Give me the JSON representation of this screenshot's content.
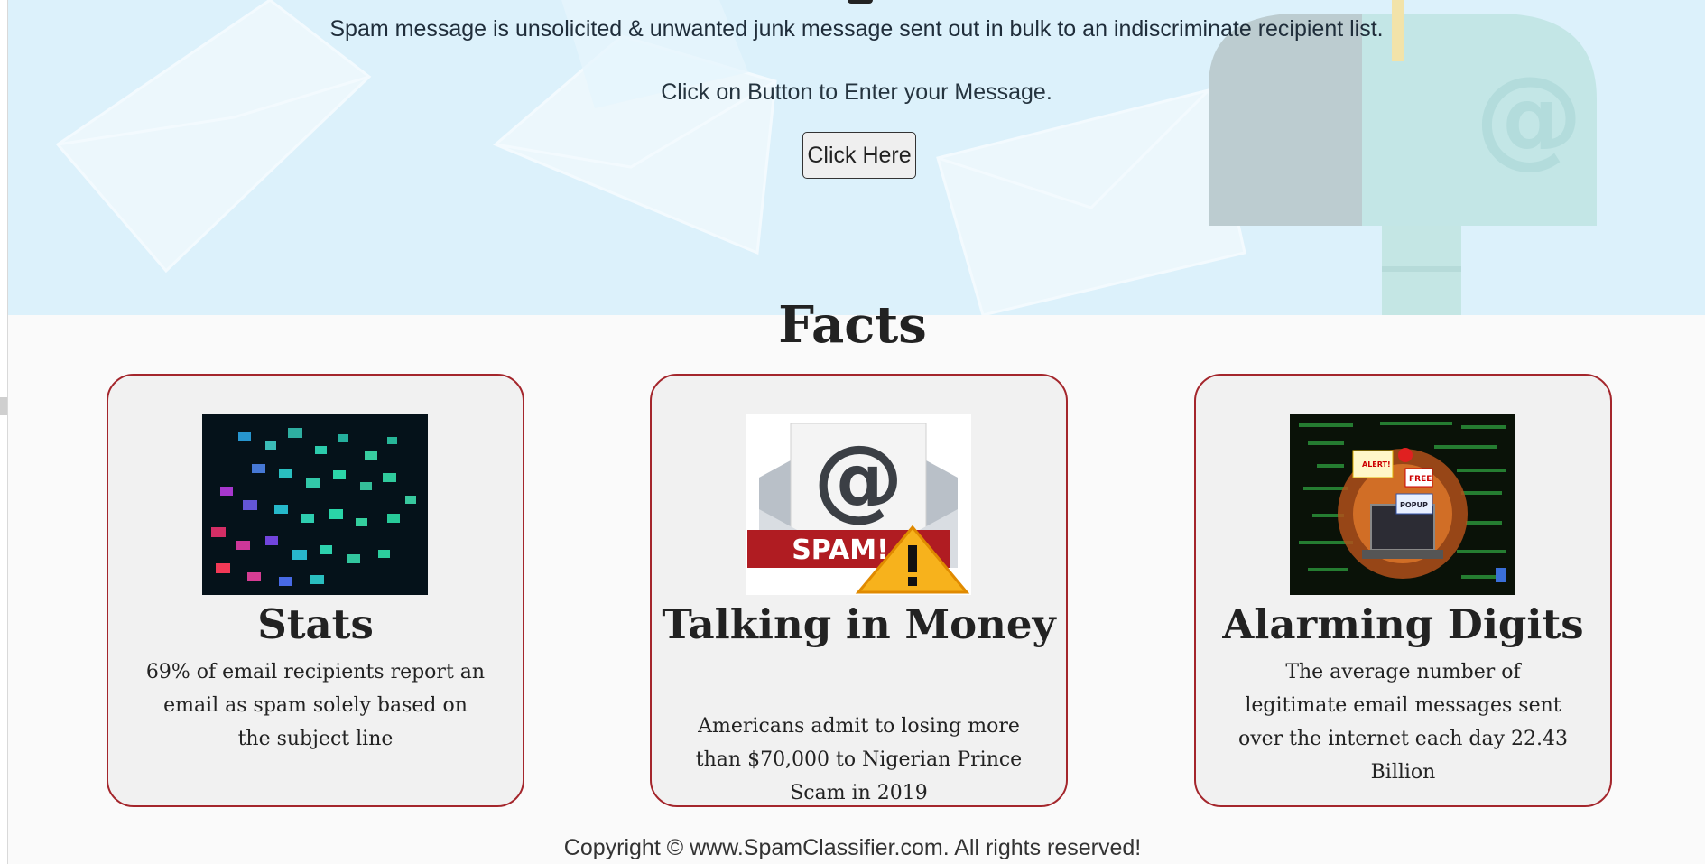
{
  "hero": {
    "description": "Spam message is unsolicited & unwanted junk message sent out in bulk to an indiscriminate recipient list.",
    "instruction": "Click on Button to Enter your Message.",
    "button_label": "Click Here"
  },
  "facts": {
    "title": "Facts",
    "cards": [
      {
        "title": "Stats",
        "text": "69% of email recipients report an email as spam solely based on the subject line",
        "image_icon": "spam-envelopes-image"
      },
      {
        "title": "Talking in Money",
        "text": "Americans admit to losing more than $70,000 to Nigerian Prince Scam in 2019",
        "image_icon": "spam-mail-image",
        "image_label": "SPAM!"
      },
      {
        "title": "Alarming Digits",
        "text": "The average number of legitimate email messages sent over the internet each day 22.43 Billion",
        "image_icon": "laptop-popups-image",
        "image_labels": [
          "ALERT!",
          "FREE",
          "POPUP"
        ]
      }
    ]
  },
  "footer": {
    "copyright": "Copyright © www.SpamClassifier.com. All rights reserved!"
  },
  "colors": {
    "hero_bg": "#dcf1fb",
    "card_border": "#a4262c",
    "card_bg": "#f1f1f1",
    "page_bg": "#fafafa"
  }
}
